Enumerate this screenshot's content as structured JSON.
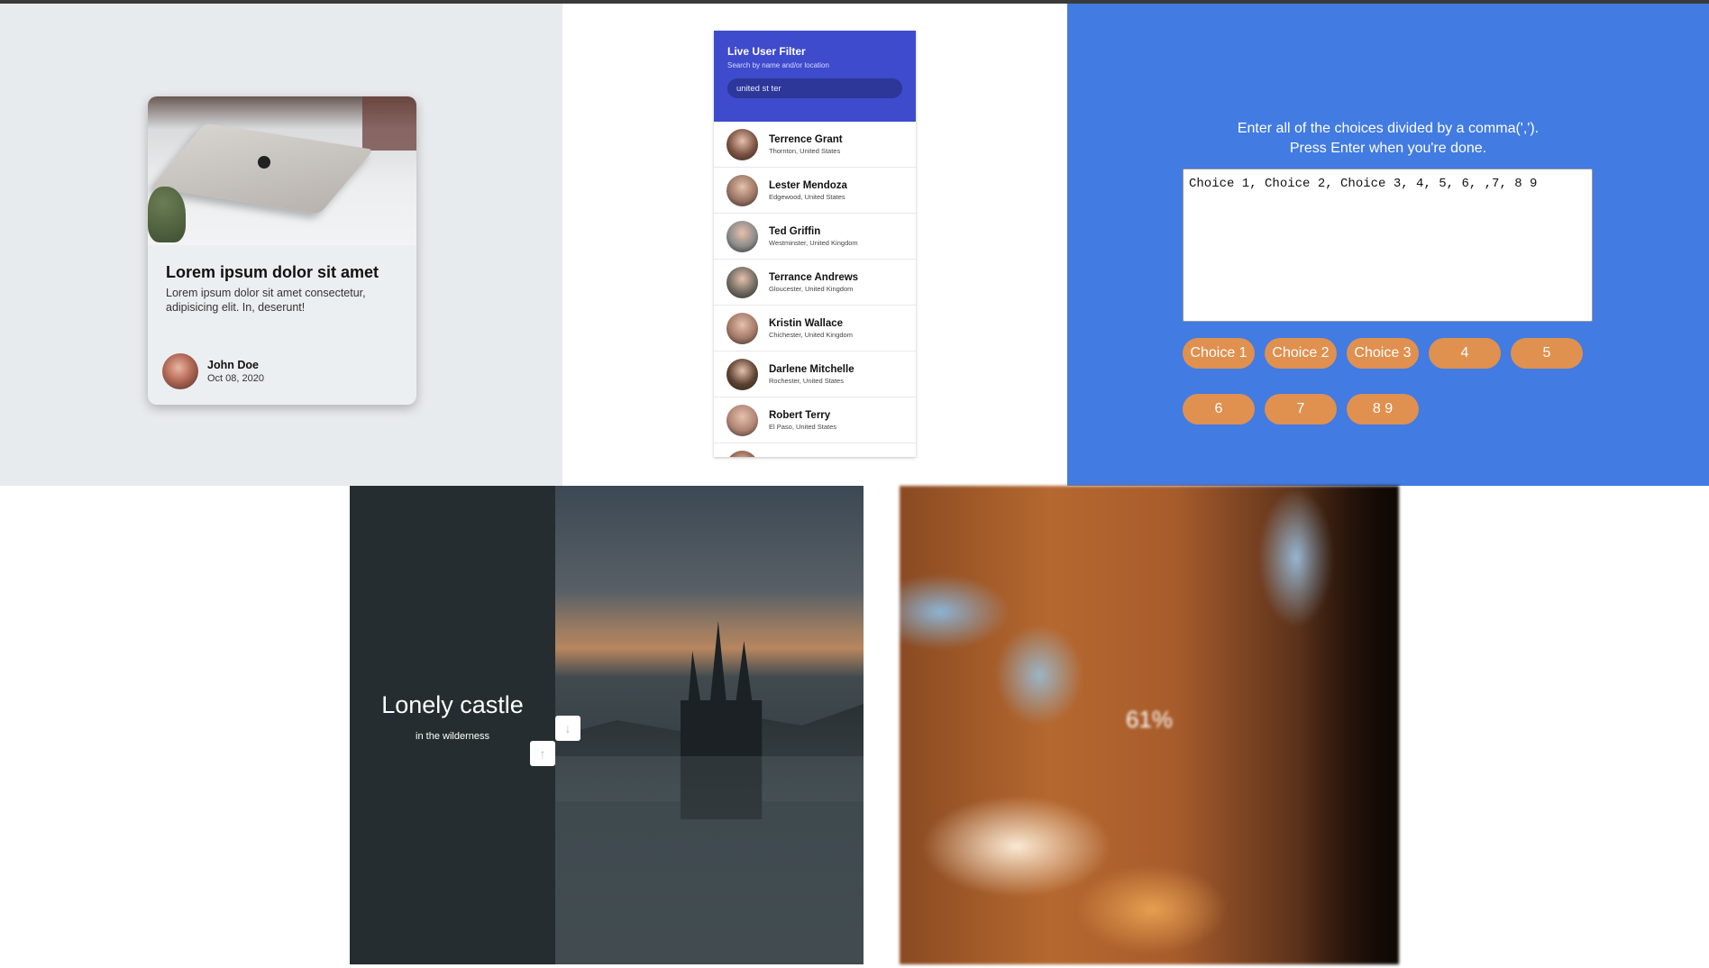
{
  "card": {
    "title": "Lorem ipsum dolor sit amet",
    "text": "Lorem ipsum dolor sit amet consectetur, adipisicing elit. In, deserunt!",
    "author_name": "John Doe",
    "date": "Oct 08, 2020"
  },
  "filter": {
    "title": "Live User Filter",
    "subtitle": "Search by name and/or location",
    "search_value": "united st ter",
    "users": [
      {
        "name": "Terrence Grant",
        "location": "Thornton, United States",
        "color": "#7a5140"
      },
      {
        "name": "Lester Mendoza",
        "location": "Edgewood, United States",
        "color": "#9b7464"
      },
      {
        "name": "Ted Griffin",
        "location": "Westminster, United Kingdom",
        "color": "#8a8a8a"
      },
      {
        "name": "Terrance Andrews",
        "location": "Gloucester, United Kingdom",
        "color": "#6f6a60"
      },
      {
        "name": "Kristin Wallace",
        "location": "Chichester, United Kingdom",
        "color": "#a27966"
      },
      {
        "name": "Darlene Mitchelle",
        "location": "Rochester, United States",
        "color": "#5b4030"
      },
      {
        "name": "Robert Terry",
        "location": "El Paso, United States",
        "color": "#b08474"
      }
    ]
  },
  "choices": {
    "instruction_line1": "Enter all of the choices divided by a comma(',').",
    "instruction_line2": "Press Enter when you're done.",
    "textarea_value": "Choice 1, Choice 2, Choice 3, 4, 5, 6, ,7, 8 9",
    "tags": [
      "Choice 1",
      "Choice 2",
      "Choice 3",
      "4",
      "5",
      "6",
      "7",
      "8 9"
    ],
    "tag_color": "#e0904f",
    "background": "#427be2"
  },
  "slider": {
    "title": "Lonely castle",
    "subtitle": "in the wilderness",
    "up_icon": "arrow-up-icon",
    "down_icon": "arrow-down-icon"
  },
  "loading": {
    "percent_text": "61%",
    "progress": 0.61
  }
}
